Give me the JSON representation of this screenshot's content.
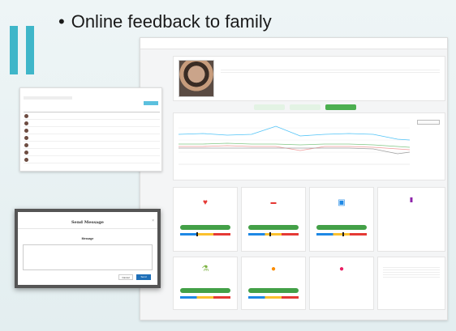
{
  "slide": {
    "bullet": "•",
    "title": "Online feedback to family"
  },
  "dashboard": {
    "brand": "",
    "profile_name": "",
    "tabs": [
      {
        "label": ""
      },
      {
        "label": ""
      },
      {
        "label": ""
      }
    ],
    "chart_title": "",
    "legend_button": ""
  },
  "cards": [
    {
      "icon": "heart-icon",
      "value": "",
      "sub": ""
    },
    {
      "icon": "lungs-icon",
      "value": "",
      "sub": ""
    },
    {
      "icon": "monitor-icon",
      "value": "",
      "sub": ""
    },
    {
      "icon": "pill-icon",
      "value": "",
      "sub": ""
    },
    {
      "icon": "bottle-icon",
      "value": "",
      "sub": ""
    },
    {
      "icon": "drop-icon",
      "value": "",
      "sub": ""
    },
    {
      "icon": "drop-icon",
      "value": "",
      "sub": ""
    }
  ],
  "dialog": {
    "title": "Send Message",
    "subtitle": "",
    "message_label": "Message",
    "cancel_label": "Cancel",
    "send_label": "Send"
  },
  "colors": {
    "accent": "#3fb6c9",
    "green": "#43a047",
    "blue": "#1e6fb8"
  }
}
